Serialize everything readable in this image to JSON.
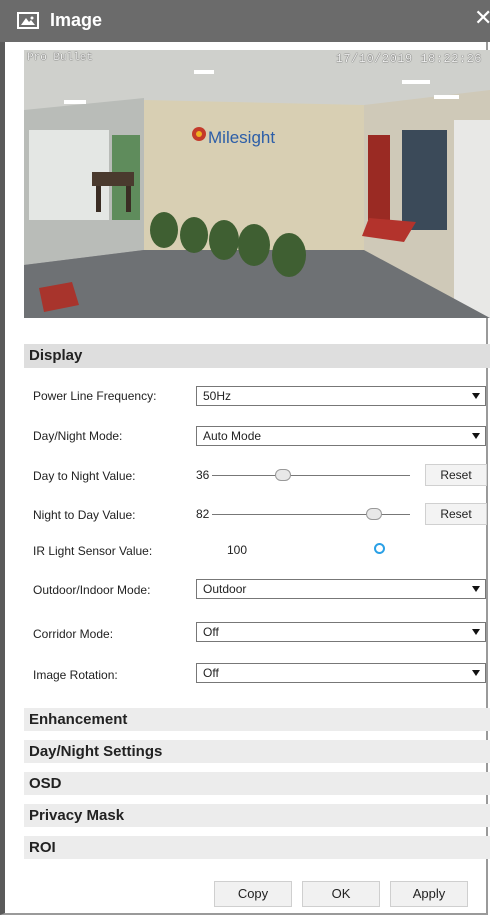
{
  "window": {
    "title": "Image"
  },
  "video": {
    "osd_name": "Pro Bullet",
    "osd_time": "17/10/2019 18:22:26",
    "logo_text": "Milesight"
  },
  "display": {
    "header": "Display",
    "power_line_frequency": {
      "label": "Power Line Frequency:",
      "value": "50Hz"
    },
    "day_night_mode": {
      "label": "Day/Night Mode:",
      "value": "Auto Mode"
    },
    "day_to_night": {
      "label": "Day to Night Value:",
      "value": "36",
      "level": 0.36,
      "reset": "Reset"
    },
    "night_to_day": {
      "label": "Night to Day Value:",
      "value": "82",
      "level": 0.82,
      "reset": "Reset"
    },
    "ir_light": {
      "label": "IR Light Sensor Value:",
      "value": "100"
    },
    "outdoor_indoor": {
      "label": "Outdoor/Indoor Mode:",
      "value": "Outdoor"
    },
    "corridor_mode": {
      "label": "Corridor Mode:",
      "value": "Off"
    },
    "image_rotation": {
      "label": "Image Rotation:",
      "value": "Off"
    }
  },
  "sections": [
    "Enhancement",
    "Day/Night Settings",
    "OSD",
    "Privacy Mask",
    "ROI"
  ],
  "buttons": {
    "copy": "Copy",
    "ok": "OK",
    "apply": "Apply"
  },
  "colors": {
    "titlebar": "#6b6b6b",
    "section_header": "#dedede",
    "accent": "#2aa0e6"
  }
}
